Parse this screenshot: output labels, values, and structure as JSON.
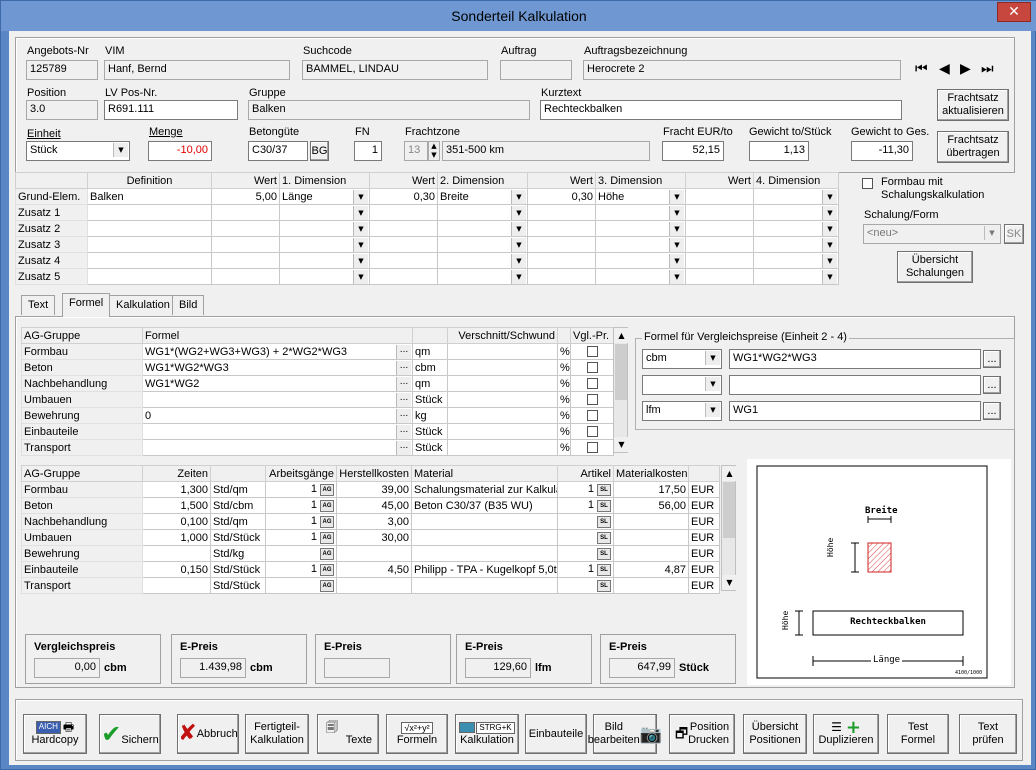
{
  "window": {
    "title": "Sonderteil Kalkulation",
    "close": "✕"
  },
  "header": {
    "angebots_nr_label": "Angebots-Nr",
    "angebots_nr": "125789",
    "vim_label": "VIM",
    "vim": "Hanf, Bernd",
    "suchcode_label": "Suchcode",
    "suchcode": "BAMMEL, LINDAU",
    "auftrag_label": "Auftrag",
    "auftrag": "",
    "auftragsbez_label": "Auftragsbezeichnung",
    "auftragsbez": "Herocrete 2",
    "position_label": "Position",
    "position": "3.0",
    "lvpos_label": "LV Pos-Nr.",
    "lvpos": "R691.111",
    "gruppe_label": "Gruppe",
    "gruppe": "Balken",
    "kurztext_label": "Kurztext",
    "kurztext": "Rechteckbalken",
    "einheit_label": "Einheit",
    "einheit": "Stück",
    "menge_label": "Menge",
    "menge": "-10,00",
    "betongute_label": "Betongüte",
    "betongute": "C30/37",
    "bg_button": "BG",
    "fn_label": "FN",
    "fn": "1",
    "frachtzone_label": "Frachtzone",
    "frachtzone_num": "13",
    "frachtzone_text": "351-500 km",
    "fracht_label": "Fracht EUR/to",
    "fracht": "52,15",
    "gewicht_label": "Gewicht to/Stück",
    "gewicht": "1,13",
    "gewicht_ges_label": "Gewicht to Ges.",
    "gewicht_ges": "-11,30",
    "frachtsatz_akt": "Frachtsatz aktualisieren",
    "frachtsatz_ueb": "Frachtsatz übertragen"
  },
  "dimensions": {
    "headers": [
      "Definition",
      "Wert",
      "1. Dimension",
      "Wert",
      "2. Dimension",
      "Wert",
      "3. Dimension",
      "Wert",
      "4. Dimension"
    ],
    "rows": [
      {
        "label": "Grund-Elem.",
        "definition": "Balken",
        "w1": "5,00",
        "d1": "Länge",
        "w2": "0,30",
        "d2": "Breite",
        "w3": "0,30",
        "d3": "Höhe",
        "w4": "",
        "d4": ""
      },
      {
        "label": "Zusatz 1",
        "definition": "",
        "w1": "",
        "d1": "",
        "w2": "",
        "d2": "",
        "w3": "",
        "d3": "",
        "w4": "",
        "d4": ""
      },
      {
        "label": "Zusatz 2",
        "definition": "",
        "w1": "",
        "d1": "",
        "w2": "",
        "d2": "",
        "w3": "",
        "d3": "",
        "w4": "",
        "d4": ""
      },
      {
        "label": "Zusatz 3",
        "definition": "",
        "w1": "",
        "d1": "",
        "w2": "",
        "d2": "",
        "w3": "",
        "d3": "",
        "w4": "",
        "d4": ""
      },
      {
        "label": "Zusatz 4",
        "definition": "",
        "w1": "",
        "d1": "",
        "w2": "",
        "d2": "",
        "w3": "",
        "d3": "",
        "w4": "",
        "d4": ""
      },
      {
        "label": "Zusatz 5",
        "definition": "",
        "w1": "",
        "d1": "",
        "w2": "",
        "d2": "",
        "w3": "",
        "d3": "",
        "w4": "",
        "d4": ""
      }
    ]
  },
  "schalung": {
    "formbau_check": "Formbau mit Schalungskalkulation",
    "label": "Schalung/Form",
    "value": "<neu>",
    "sk_button": "SK",
    "uebersicht_button": "Übersicht Schalungen"
  },
  "tabs": [
    "Text",
    "Formel",
    "Kalkulation",
    "Bild"
  ],
  "formel_table": {
    "headers": [
      "AG-Gruppe",
      "Formel",
      "",
      "Verschnitt/Schwund",
      "",
      "Vgl.-Pr."
    ],
    "rows": [
      {
        "group": "Formbau",
        "formula": "WG1*(WG2+WG3+WG3) + 2*WG2*WG3",
        "unit": "qm",
        "pct": "%"
      },
      {
        "group": "Beton",
        "formula": "WG1*WG2*WG3",
        "unit": "cbm",
        "pct": "%"
      },
      {
        "group": "Nachbehandlung",
        "formula": "WG1*WG2",
        "unit": "qm",
        "pct": "%"
      },
      {
        "group": "Umbauen",
        "formula": "",
        "unit": "Stück",
        "pct": "%"
      },
      {
        "group": "Bewehrung",
        "formula": "0",
        "unit": "kg",
        "pct": "%"
      },
      {
        "group": "Einbauteile",
        "formula": "",
        "unit": "Stück",
        "pct": "%"
      },
      {
        "group": "Transport",
        "formula": "",
        "unit": "Stück",
        "pct": "%"
      }
    ],
    "dots": "..."
  },
  "vergleich": {
    "title": "Formel für Vergleichspreise (Einheit 2 - 4)",
    "rows": [
      {
        "unit": "cbm",
        "formula": "WG1*WG2*WG3"
      },
      {
        "unit": "",
        "formula": ""
      },
      {
        "unit": "lfm",
        "formula": "WG1"
      }
    ]
  },
  "kalk_table": {
    "headers": [
      "AG-Gruppe",
      "Zeiten",
      "",
      "Arbeitsgänge",
      "Herstellkosten",
      "Material",
      "Artikel",
      "Materialkosten",
      ""
    ],
    "rows": [
      {
        "group": "Formbau",
        "zeit": "1,300",
        "einheit": "Std/qm",
        "ag": "1",
        "hk": "39,00",
        "material": "Schalungsmaterial zur Kalkula",
        "artikel": "1",
        "mk": "17,50",
        "cur": "EUR"
      },
      {
        "group": "Beton",
        "zeit": "1,500",
        "einheit": "Std/cbm",
        "ag": "1",
        "hk": "45,00",
        "material": "Beton C30/37 (B35 WU)",
        "artikel": "1",
        "mk": "56,00",
        "cur": "EUR"
      },
      {
        "group": "Nachbehandlung",
        "zeit": "0,100",
        "einheit": "Std/qm",
        "ag": "1",
        "hk": "3,00",
        "material": "",
        "artikel": "",
        "mk": "",
        "cur": "EUR"
      },
      {
        "group": "Umbauen",
        "zeit": "1,000",
        "einheit": "Std/Stück",
        "ag": "1",
        "hk": "30,00",
        "material": "",
        "artikel": "",
        "mk": "",
        "cur": "EUR"
      },
      {
        "group": "Bewehrung",
        "zeit": "",
        "einheit": "Std/kg",
        "ag": "",
        "hk": "",
        "material": "",
        "artikel": "",
        "mk": "",
        "cur": "EUR"
      },
      {
        "group": "Einbauteile",
        "zeit": "0,150",
        "einheit": "Std/Stück",
        "ag": "1",
        "hk": "4,50",
        "material": "Philipp - TPA - Kugelkopf 5,0t",
        "artikel": "1",
        "mk": "4,87",
        "cur": "EUR"
      },
      {
        "group": "Transport",
        "zeit": "",
        "einheit": "Std/Stück",
        "ag": "",
        "hk": "",
        "material": "",
        "artikel": "",
        "mk": "",
        "cur": "EUR"
      }
    ],
    "ag_tag": "AG",
    "sl_tag": "SL"
  },
  "prices": [
    {
      "label": "Vergleichspreis",
      "value": "0,00",
      "unit": "cbm"
    },
    {
      "label": "E-Preis",
      "value": "1.439,98",
      "unit": "cbm"
    },
    {
      "label": "E-Preis",
      "value": "",
      "unit": ""
    },
    {
      "label": "E-Preis",
      "value": "129,60",
      "unit": "lfm"
    },
    {
      "label": "E-Preis",
      "value": "647,99",
      "unit": "Stück"
    }
  ],
  "drawing": {
    "breite": "Breite",
    "hoehe": "Höhe",
    "name": "Rechteckbalken",
    "laenge": "Länge",
    "code": "4100/1000"
  },
  "toolbar": {
    "hardcopy": "Hardcopy",
    "sichern": "Sichern",
    "abbruch": "Abbruch",
    "fertigteil": "Fertigteil-\nKalkulation",
    "texte": "Texte",
    "formeln": "Formeln",
    "kalkulation": "Kalkulation",
    "kalk_key": "STRG+K",
    "einbauteile": "Einbauteile",
    "bild": "Bild\nbearbeiten",
    "position_drucken": "Position\nDrucken",
    "uebersicht_pos": "Übersicht\nPositionen",
    "duplizieren": "Duplizieren",
    "test_formel": "Test\nFormel",
    "text_pruefen": "Text\nprüfen",
    "formula_glyph": "√x²+y²",
    "aich_glyph": "AICH"
  },
  "colors": {
    "window_bg": "#5b86c4",
    "client_bg": "#f0f0f0",
    "negative": "#e00000"
  }
}
